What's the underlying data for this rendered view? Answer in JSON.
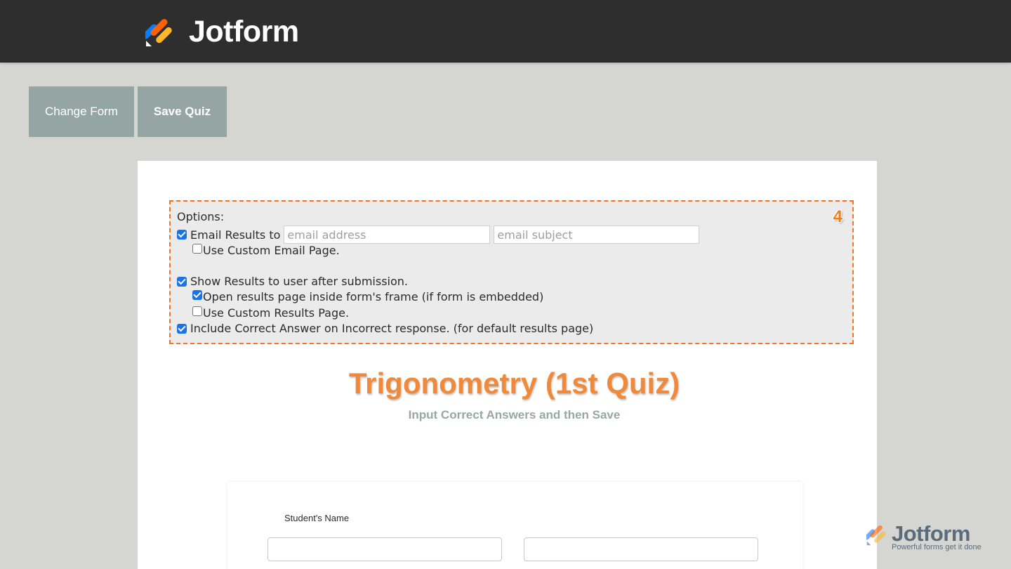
{
  "brand": {
    "name": "Jotform"
  },
  "toolbar": {
    "change_form": "Change Form",
    "save_quiz": "Save Quiz"
  },
  "options": {
    "heading": "Options:",
    "step_badge": "4",
    "email_results": {
      "label": "Email Results to",
      "checked": true,
      "address_placeholder": "email address",
      "subject_placeholder": "email subject"
    },
    "custom_email_page": {
      "label": "Use Custom Email Page.",
      "checked": false
    },
    "show_results": {
      "label": "Show Results to user after submission.",
      "checked": true
    },
    "open_in_frame": {
      "label": "Open results page inside form's frame (if form is embedded)",
      "checked": true
    },
    "custom_results_page": {
      "label": "Use Custom Results Page.",
      "checked": false
    },
    "include_correct": {
      "label": "Include Correct Answer on Incorrect response. (for default results page)",
      "checked": true
    }
  },
  "quiz": {
    "title": "Trigonometry (1st Quiz)",
    "subtitle": "Input Correct Answers and then Save"
  },
  "form": {
    "student_name_label": "Student's Name"
  },
  "watermark": {
    "name": "Jotform",
    "tagline": "Powerful forms get it done"
  },
  "colors": {
    "accent": "#f07525",
    "header": "#2e2e2e",
    "button": "#95a5a3",
    "title": "#f08a3a"
  }
}
